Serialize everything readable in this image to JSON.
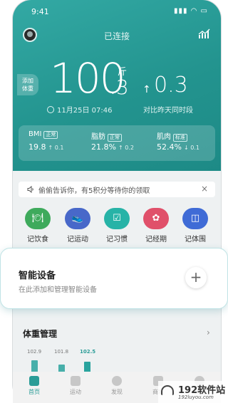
{
  "status_bar": {
    "time": "9:41",
    "icons_text": "▮▮▮ ◠ ▭"
  },
  "header": {
    "connection": "已连接"
  },
  "add_badge": {
    "line1": "添加",
    "line2": "体重"
  },
  "weight": {
    "integer": "100",
    "decimal": ".3",
    "unit": "斤",
    "datetime": "11月25日 07:46"
  },
  "delta": {
    "arrow": "↑",
    "value": "0.3",
    "note": "对比昨天同时段"
  },
  "stats": [
    {
      "name": "BMI",
      "tag": "正常",
      "value": "19.8",
      "change": "↑ 0.1"
    },
    {
      "name": "脂肪",
      "tag": "正常",
      "value": "21.8%",
      "change": "↑ 0.2"
    },
    {
      "name": "肌肉",
      "tag": "标准",
      "value": "52.4%",
      "change": "↓ 0.1"
    }
  ],
  "notice": {
    "message": "偷偷告诉你，有5积分等待你的领取",
    "close": "×"
  },
  "actions": [
    {
      "label": "记饮食",
      "color": "#3eaa5c",
      "glyph": "🍽"
    },
    {
      "label": "记运动",
      "color": "#4868c9",
      "glyph": "👟"
    },
    {
      "label": "记习惯",
      "color": "#27b3a7",
      "glyph": "☑"
    },
    {
      "label": "记经期",
      "color": "#e0506a",
      "glyph": "✿"
    },
    {
      "label": "记体围",
      "color": "#3f6bd6",
      "glyph": "◫"
    }
  ],
  "smart_device": {
    "title": "智能设备",
    "subtitle": "在此添加和管理智能设备",
    "plus": "+"
  },
  "weight_mgmt": {
    "title": "体重管理",
    "chevron": "›",
    "bars": [
      {
        "label": "102.9",
        "value": 102.9,
        "active": false
      },
      {
        "label": "101.8",
        "value": 101.8,
        "active": false
      },
      {
        "label": "102.5",
        "value": 102.5,
        "active": true
      }
    ]
  },
  "tabs": [
    {
      "label": "首页",
      "active": true
    },
    {
      "label": "运动",
      "active": false
    },
    {
      "label": "发现",
      "active": false
    },
    {
      "label": "商城",
      "active": false
    },
    {
      "label": "我的",
      "active": false
    }
  ],
  "watermark": {
    "line1": "192软件站",
    "line2": "192luyou.com"
  },
  "colors": {
    "brand": "#23948f",
    "accent": "#29a39e"
  }
}
